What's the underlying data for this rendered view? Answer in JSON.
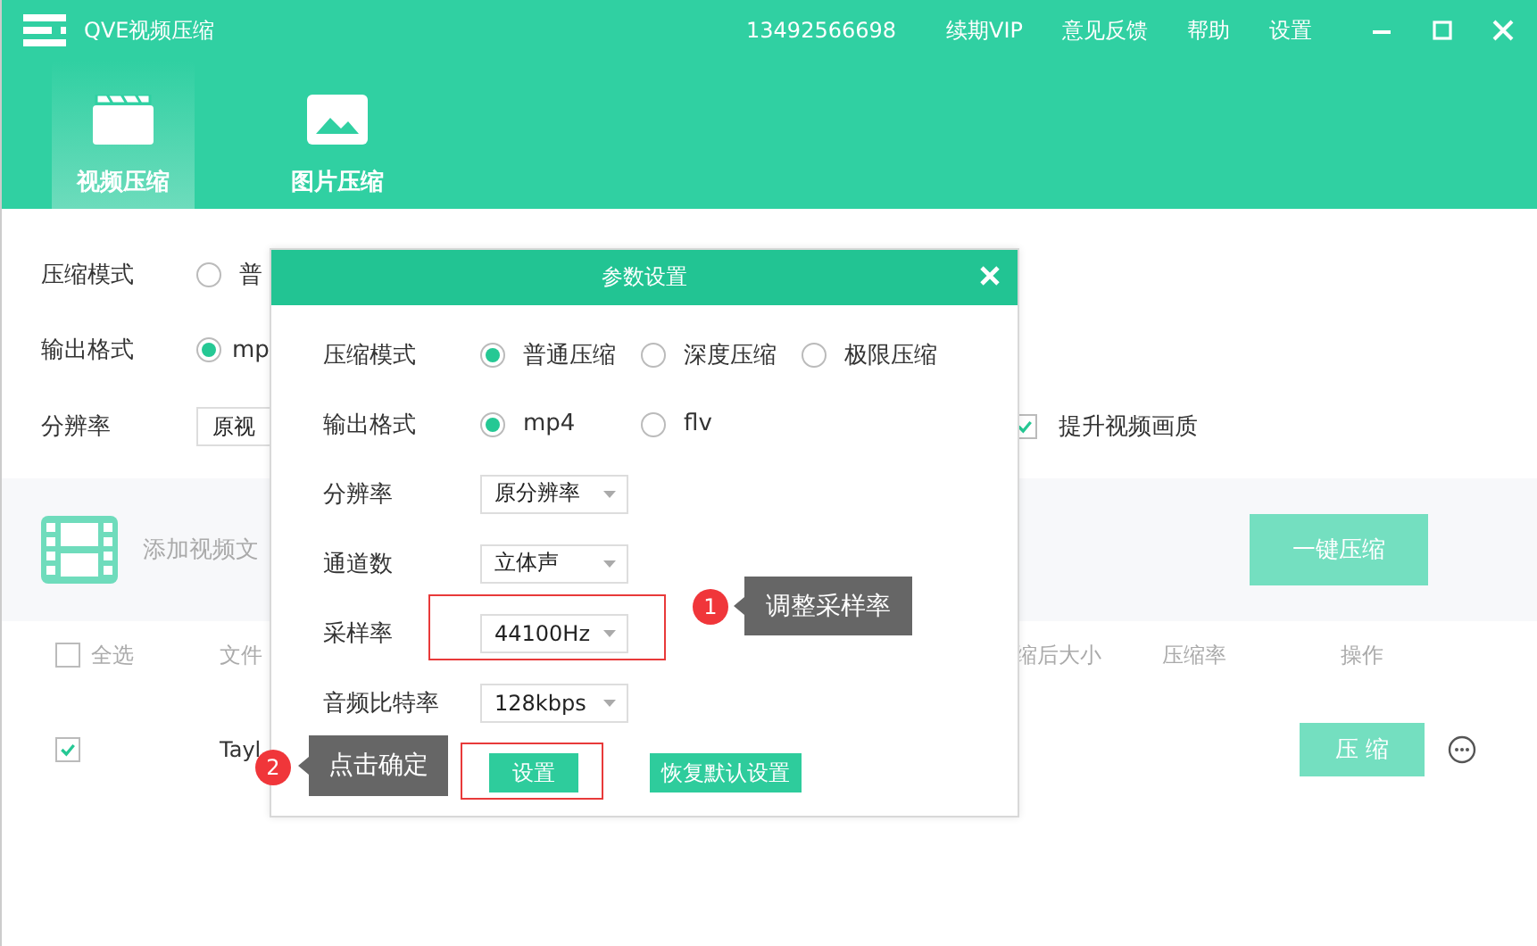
{
  "title_bar": {
    "app_name": "QVE视频压缩",
    "phone": "13492566698",
    "links": [
      "续期VIP",
      "意见反馈",
      "帮助",
      "设置"
    ]
  },
  "nav_tabs": [
    {
      "label": "视频压缩",
      "kind": "video",
      "selected": true
    },
    {
      "label": "图片压缩",
      "kind": "image",
      "selected": false
    }
  ],
  "settings": {
    "compress_mode": {
      "label": "压缩模式",
      "option": {
        "label": "普",
        "selected": false
      }
    },
    "output_format": {
      "label": "输出格式",
      "option": {
        "label": "mp",
        "selected": true
      }
    },
    "resolution": {
      "label": "分辨率",
      "value": "原视"
    },
    "enhance": {
      "label": "提升视频画质",
      "checked": true
    }
  },
  "add_bar": {
    "hint": "添加视频文",
    "button": "一键压缩"
  },
  "file_table": {
    "select_all": {
      "label": "全选",
      "checked": false
    },
    "columns": [
      "文件",
      "缩后大小",
      "压缩率",
      "操作"
    ],
    "rows": [
      {
        "checked": true,
        "name": "Tayl",
        "button": "压 缩"
      }
    ]
  },
  "dialog": {
    "title": "参数设置",
    "radio_groups": [
      {
        "label": "压缩模式",
        "options": [
          {
            "label": "普通压缩",
            "selected": true
          },
          {
            "label": "深度压缩",
            "selected": false
          },
          {
            "label": "极限压缩",
            "selected": false
          }
        ]
      },
      {
        "label": "输出格式",
        "options": [
          {
            "label": "mp4",
            "selected": true
          },
          {
            "label": "flv",
            "selected": false
          }
        ]
      }
    ],
    "dropdowns": [
      {
        "label": "分辨率",
        "value": "原分辨率"
      },
      {
        "label": "通道数",
        "value": "立体声"
      },
      {
        "label": "采样率",
        "value": "44100Hz"
      },
      {
        "label": "音频比特率",
        "value": "128kbps"
      }
    ],
    "buttons": [
      {
        "label": "设置",
        "kind": "primary"
      },
      {
        "label": "恢复默认设置",
        "kind": "secondary"
      }
    ]
  },
  "annotations": [
    {
      "number": "1",
      "text": "调整采样率"
    },
    {
      "number": "2",
      "text": "点击确定"
    }
  ]
}
